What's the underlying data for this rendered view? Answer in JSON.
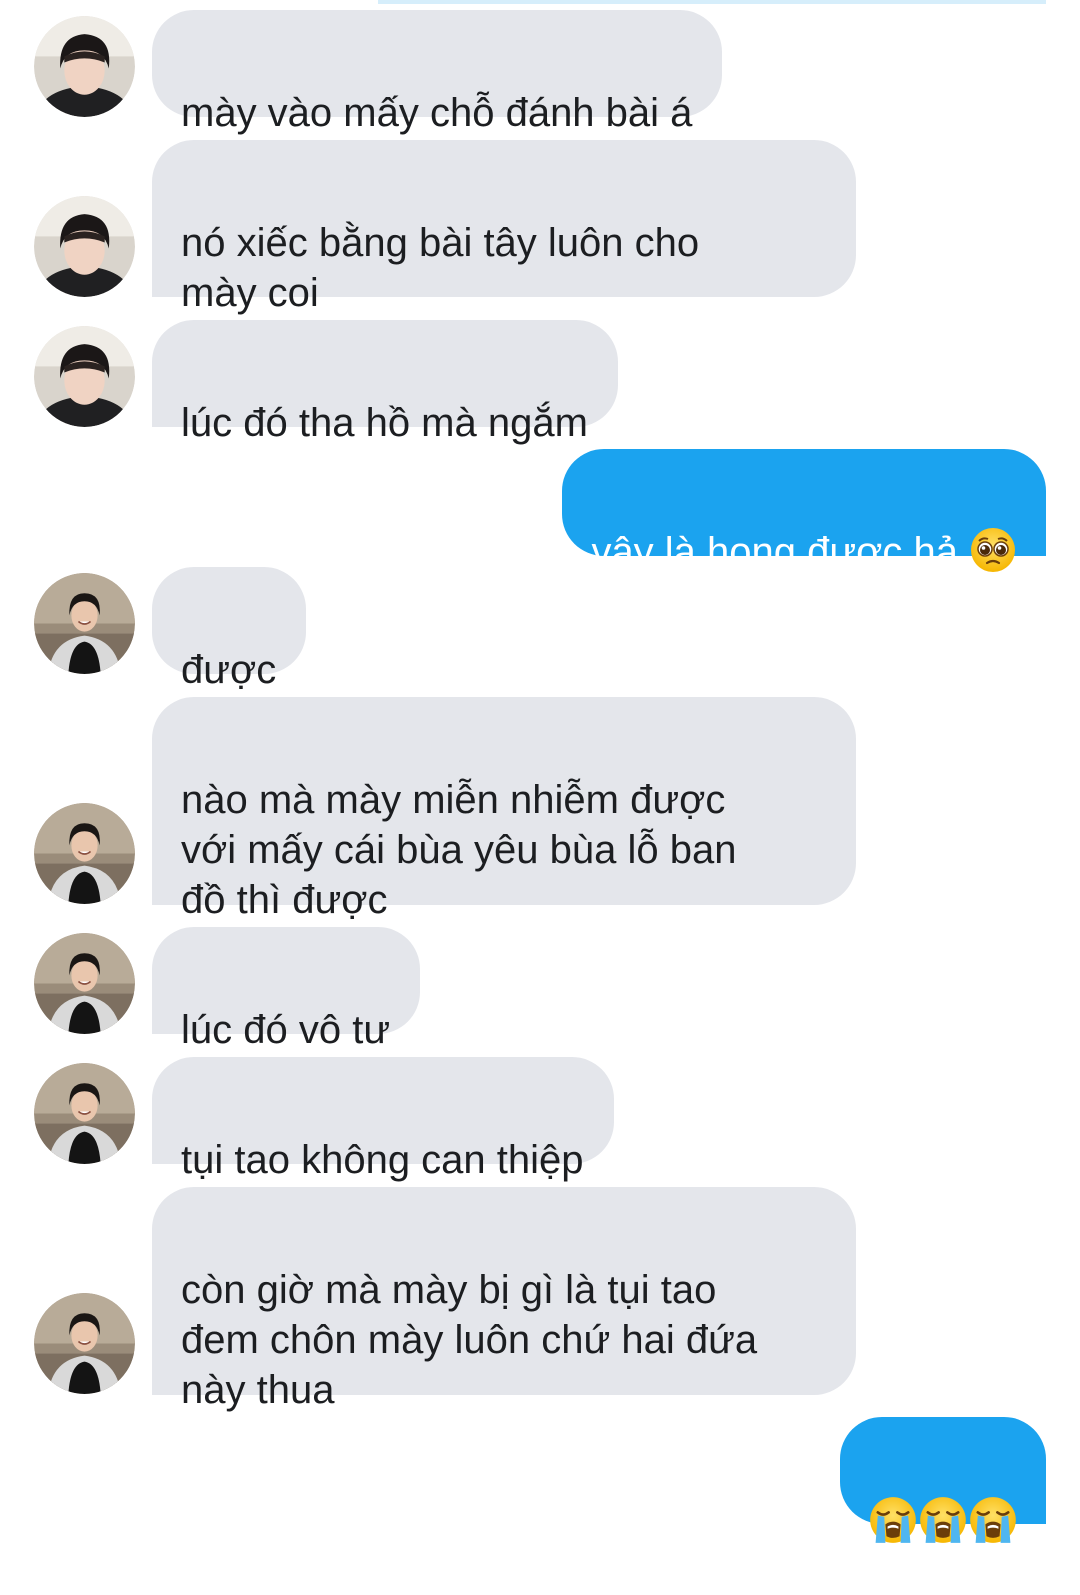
{
  "messages": [
    {
      "sender": "contact_a",
      "text": "mày vào mấy chỗ đánh bài á"
    },
    {
      "sender": "contact_a",
      "text": "nó xiếc bằng bài tây luôn cho\nmày coi"
    },
    {
      "sender": "contact_a",
      "text": "lúc đó tha hồ mà ngắm"
    },
    {
      "sender": "me",
      "text": "vậy là hong được hả",
      "emoji": "pleading-face"
    },
    {
      "sender": "contact_b",
      "text": "được"
    },
    {
      "sender": "contact_b",
      "text": "nào mà mày miễn nhiễm được\nvới mấy cái bùa yêu bùa lỗ ban\nđồ thì được"
    },
    {
      "sender": "contact_b",
      "text": "lúc đó vô tư"
    },
    {
      "sender": "contact_b",
      "text": "tụi tao không can thiệp"
    },
    {
      "sender": "contact_b",
      "text": "còn giờ mà mày bị gì là tụi tao\nđem chôn mày luôn chứ hai đứa\nnày thua"
    },
    {
      "sender": "me",
      "emoji": [
        "loudly-crying-face",
        "loudly-crying-face",
        "loudly-crying-face"
      ]
    }
  ],
  "colors": {
    "incoming_bubble": "#e4e6eb",
    "outgoing_bubble": "#1ba3ef",
    "incoming_text": "#1c1e21",
    "outgoing_text": "#ffffff"
  }
}
